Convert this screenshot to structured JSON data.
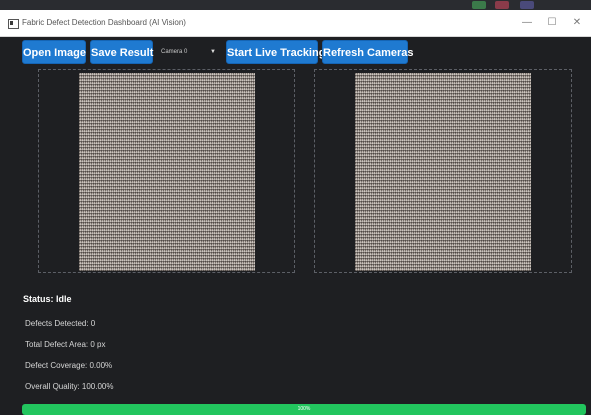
{
  "window": {
    "title": "Fabric Defect Detection Dashboard (AI Vision)",
    "minimize_glyph": "—",
    "maximize_glyph": "☐",
    "close_glyph": "✕"
  },
  "toolbar": {
    "open_image_label": "Open Image",
    "save_result_label": "Save Result",
    "camera_select": {
      "selected": "Camera 0"
    },
    "start_tracking_label": "Start Live Tracking",
    "refresh_cameras_label": "Refresh Cameras"
  },
  "status": {
    "title": "Status: Idle",
    "defects_detected": "Defects Detected: 0",
    "total_defect_area": "Total Defect Area: 0 px",
    "defect_coverage": "Defect Coverage: 0.00%",
    "overall_quality": "Overall Quality: 100.00%"
  },
  "progress": {
    "value": 1.0,
    "label": "100%"
  },
  "colors": {
    "accent_button": "#1f7ad1",
    "progress_fill": "#22c55e",
    "background": "#1e1f22"
  },
  "icons": {
    "app": "app-icon",
    "dropdown": "chevron-down-icon"
  }
}
